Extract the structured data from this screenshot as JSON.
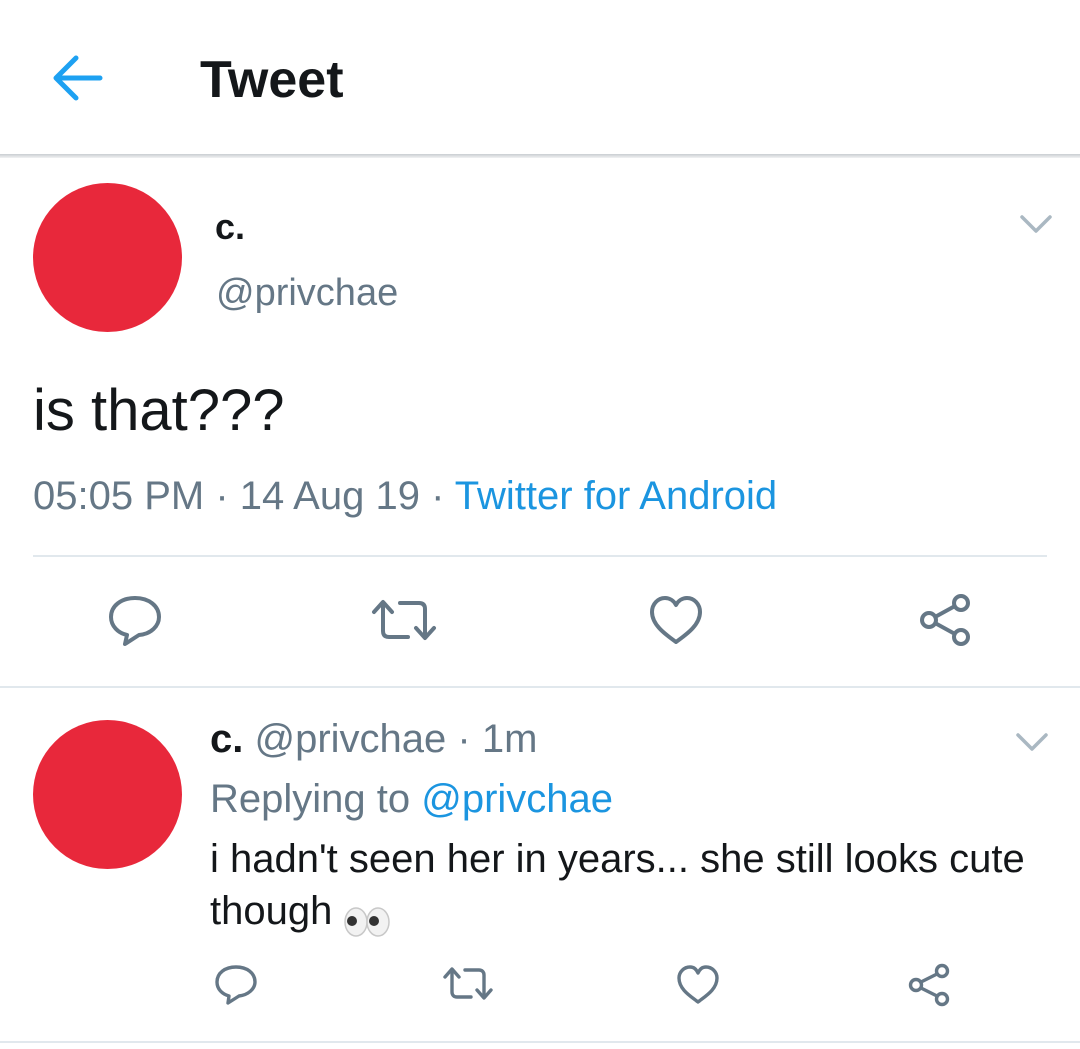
{
  "header": {
    "title": "Tweet"
  },
  "tweet": {
    "name": "c.",
    "handle": "@privchae",
    "text": "is that???",
    "time": "05:05 PM",
    "sep1": " · ",
    "date": "14 Aug 19",
    "sep2": " · ",
    "source": "Twitter for Android"
  },
  "reply": {
    "name": "c.",
    "handle": "@privchae",
    "sep": " · ",
    "age": "1m",
    "replying_prefix": "Replying to ",
    "replying_to": "@privchae",
    "text": "i hadn't seen her in years... she still looks cute though"
  },
  "colors": {
    "accent": "#1da1f2",
    "link": "#1b95e0",
    "avatar": "#e8283b",
    "secondary_text": "#657786",
    "icon_gray": "#657786"
  },
  "icons": [
    "back-arrow-icon",
    "chevron-down-icon",
    "reply-icon",
    "retweet-icon",
    "like-icon",
    "share-icon",
    "eyes-emoji-icon"
  ]
}
